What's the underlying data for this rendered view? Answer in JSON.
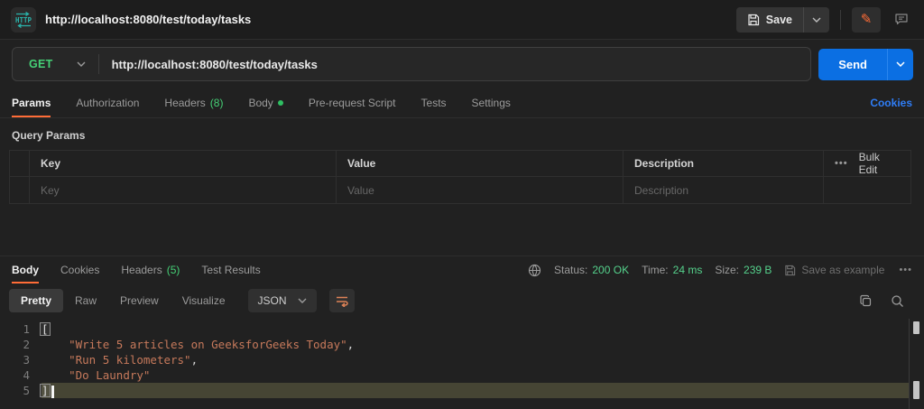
{
  "app": {
    "title": "http://localhost:8080/test/today/tasks"
  },
  "topbar": {
    "save_label": "Save"
  },
  "request": {
    "method": "GET",
    "url": "http://localhost:8080/test/today/tasks",
    "send_label": "Send"
  },
  "request_tabs": {
    "params": "Params",
    "authorization": "Authorization",
    "headers": "Headers",
    "headers_count": "(8)",
    "body": "Body",
    "pre_request": "Pre-request Script",
    "tests": "Tests",
    "settings": "Settings",
    "cookies_link": "Cookies"
  },
  "query_params": {
    "title": "Query Params",
    "col_key": "Key",
    "col_value": "Value",
    "col_description": "Description",
    "bulk_edit": "Bulk Edit",
    "ph_key": "Key",
    "ph_value": "Value",
    "ph_description": "Description"
  },
  "response": {
    "tab_body": "Body",
    "tab_cookies": "Cookies",
    "tab_headers": "Headers",
    "headers_count": "(5)",
    "tab_test_results": "Test Results",
    "status_label": "Status:",
    "status_value": "200 OK",
    "time_label": "Time:",
    "time_value": "24 ms",
    "size_label": "Size:",
    "size_value": "239 B",
    "save_as_example": "Save as example",
    "view_pretty": "Pretty",
    "view_raw": "Raw",
    "view_preview": "Preview",
    "view_visualize": "Visualize",
    "format": "JSON"
  },
  "code": {
    "lines": [
      {
        "num": "1",
        "open": "["
      },
      {
        "num": "2",
        "string": "\"Write 5 articles on GeeksforGeeks Today\"",
        "comma": ","
      },
      {
        "num": "3",
        "string": "\"Run 5 kilometers\"",
        "comma": ","
      },
      {
        "num": "4",
        "string": "\"Do Laundry\""
      },
      {
        "num": "5",
        "close": "]"
      }
    ]
  },
  "icons": {
    "more_options": "•••",
    "http_logo": "HTTP"
  },
  "colors": {
    "accent_orange": "#ff6c37",
    "method_get_green": "#45d176",
    "send_blue": "#0b6fe3",
    "status_green": "#55d28c",
    "link_blue": "#2f7df6",
    "json_string": "#c6795b",
    "http_icon_teal": "#2ab3ab",
    "active_line": "#464534"
  }
}
